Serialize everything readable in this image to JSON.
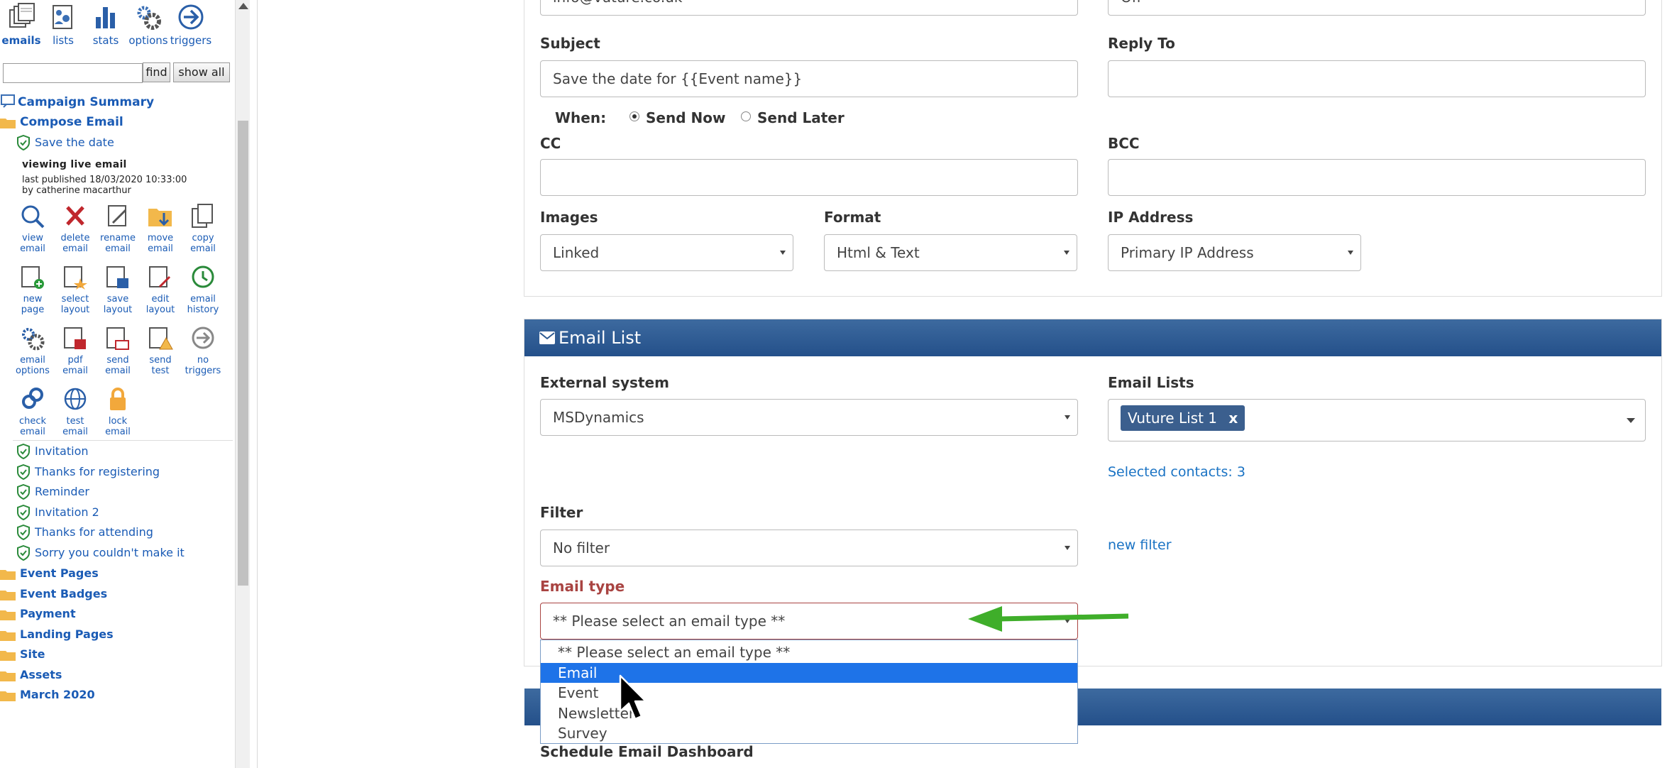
{
  "toolbar": {
    "items": [
      {
        "label": "emails",
        "icon": "emails-icon"
      },
      {
        "label": "lists",
        "icon": "lists-icon"
      },
      {
        "label": "stats",
        "icon": "stats-icon"
      },
      {
        "label": "options",
        "icon": "options-icon"
      },
      {
        "label": "triggers",
        "icon": "triggers-icon"
      }
    ]
  },
  "sidebar": {
    "search_value": "",
    "find_label": "find",
    "show_all_label": "show all",
    "campaign_summary": "Campaign Summary",
    "compose_email": "Compose Email",
    "current_email": "Save the date",
    "viewing_status": "viewing  live  email",
    "last_published": "last published 18/03/2020 10:33:00",
    "published_by": "by catherine macarthur",
    "actions": [
      {
        "l1": "view",
        "l2": "email",
        "icon": "view-email-icon"
      },
      {
        "l1": "delete",
        "l2": "email",
        "icon": "delete-email-icon"
      },
      {
        "l1": "rename",
        "l2": "email",
        "icon": "rename-email-icon"
      },
      {
        "l1": "move",
        "l2": "email",
        "icon": "move-email-icon"
      },
      {
        "l1": "copy",
        "l2": "email",
        "icon": "copy-email-icon"
      },
      {
        "l1": "new",
        "l2": "page",
        "icon": "new-page-icon"
      },
      {
        "l1": "select",
        "l2": "layout",
        "icon": "select-layout-icon"
      },
      {
        "l1": "save",
        "l2": "layout",
        "icon": "save-layout-icon"
      },
      {
        "l1": "edit",
        "l2": "layout",
        "icon": "edit-layout-icon"
      },
      {
        "l1": "email",
        "l2": "history",
        "icon": "email-history-icon"
      },
      {
        "l1": "email",
        "l2": "options",
        "icon": "email-options-icon"
      },
      {
        "l1": "pdf",
        "l2": "email",
        "icon": "pdf-email-icon"
      },
      {
        "l1": "send",
        "l2": "email",
        "icon": "send-email-icon"
      },
      {
        "l1": "send",
        "l2": "test",
        "icon": "send-test-icon"
      },
      {
        "l1": "no",
        "l2": "triggers",
        "icon": "no-triggers-icon"
      },
      {
        "l1": "check",
        "l2": "email",
        "icon": "check-email-icon"
      },
      {
        "l1": "test",
        "l2": "email",
        "icon": "test-email-icon"
      },
      {
        "l1": "lock",
        "l2": "email",
        "icon": "lock-email-icon"
      }
    ],
    "emails": [
      "Invitation",
      "Thanks for registering",
      "Reminder",
      "Invitation 2",
      "Thanks for attending",
      "Sorry you couldn't make it"
    ],
    "folders": [
      "Event Pages",
      "Event Badges",
      "Payment",
      "Landing Pages",
      "Site",
      "Assets",
      "March 2020"
    ]
  },
  "form": {
    "from_value": "info@vuture.co.uk",
    "tracking_value": "Off",
    "subject_label": "Subject",
    "subject_value": "Save the date for {{Event name}}",
    "reply_to_label": "Reply To",
    "reply_to_value": "",
    "when_label": "When:",
    "send_now_label": "Send Now",
    "send_later_label": "Send Later",
    "cc_label": "CC",
    "bcc_label": "BCC",
    "images_label": "Images",
    "images_value": "Linked",
    "format_label": "Format",
    "format_value": "Html & Text",
    "ip_label": "IP Address",
    "ip_value": "Primary IP Address"
  },
  "email_list": {
    "title": "Email List",
    "external_system_label": "External system",
    "external_system_value": "MSDynamics",
    "email_lists_label": "Email Lists",
    "selected_list": "Vuture List 1",
    "tag_remove": "x",
    "selected_contacts": "Selected contacts: 3",
    "filter_label": "Filter",
    "filter_value": "No filter",
    "new_filter_link": "new filter",
    "email_type_label": "Email type",
    "email_type_value": "** Please select an email type **",
    "email_type_options": [
      "** Please select an email type **",
      "Email",
      "Event",
      "Newsletter",
      "Survey"
    ],
    "highlighted_option": "Email"
  },
  "schedule": {
    "title": "Schedule Email Dashboard"
  },
  "colors": {
    "link": "#1a5bb5",
    "panel_header": "#2c5a91",
    "required_label": "#a94442",
    "selected_option": "#1e73e8",
    "annotation_arrow": "#3fae2a"
  }
}
